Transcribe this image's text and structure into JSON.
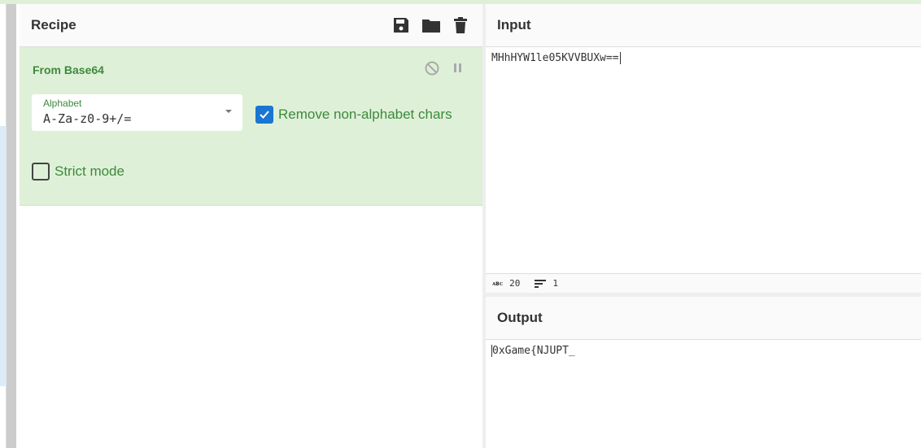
{
  "recipe": {
    "title": "Recipe",
    "icons": [
      "save-icon",
      "folder-icon",
      "trash-icon"
    ],
    "operation": {
      "name": "From Base64",
      "controls": [
        "disable-icon",
        "pause-icon"
      ],
      "alphabet": {
        "label": "Alphabet",
        "value": "A-Za-z0-9+/="
      },
      "remove_non_alphabet": {
        "label": "Remove non-alphabet chars",
        "checked": true
      },
      "strict_mode": {
        "label": "Strict mode",
        "checked": false
      }
    }
  },
  "input": {
    "title": "Input",
    "value": "MHhHYW1le05KVVBUXw==",
    "status": {
      "length": "20",
      "lines": "1"
    }
  },
  "output": {
    "title": "Output",
    "value": "0xGame{NJUPT_"
  },
  "colors": {
    "op_bg": "#dff0d8",
    "op_text": "#3c8a3c",
    "checkbox": "#1976d2"
  }
}
